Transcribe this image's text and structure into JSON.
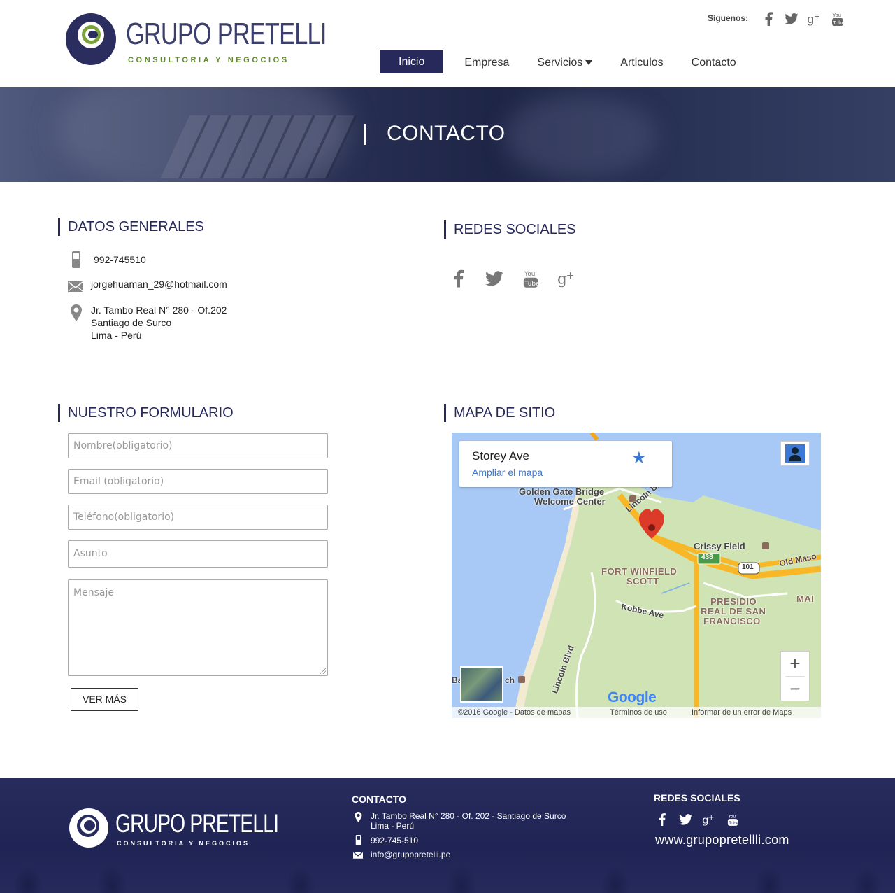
{
  "header": {
    "brand": {
      "name": "GRUPO PRETELLI",
      "tagline": "CONSULTORIA Y NEGOCIOS"
    },
    "follow_label": "Síguenos:",
    "social_icons": [
      "facebook-icon",
      "twitter-icon",
      "google-plus-icon",
      "youtube-icon"
    ],
    "nav": [
      {
        "label": "Inicio",
        "active": true
      },
      {
        "label": "Empresa"
      },
      {
        "label": "Servicios",
        "dropdown": true
      },
      {
        "label": "Articulos"
      },
      {
        "label": "Contacto"
      }
    ]
  },
  "banner": {
    "title": "CONTACTO"
  },
  "datos": {
    "title": "DATOS GENERALES",
    "phone": "992-745510",
    "email": "jorgehuaman_29@hotmail.com",
    "address": [
      "Jr. Tambo Real N° 280 - Of.202",
      "Santiago de Surco",
      "Lima - Perú"
    ]
  },
  "redes": {
    "title": "REDES SOCIALES"
  },
  "form": {
    "title": "NUESTRO FORMULARIO",
    "fields": {
      "nombre": "Nombre(obligatorio)",
      "email": "Email (obligatorio)",
      "telefono": "Teléfono(obligatorio)",
      "asunto": "Asunto",
      "mensaje": "Mensaje"
    },
    "submit_label": "VER MÁS"
  },
  "map": {
    "title": "MAPA DE SITIO",
    "card_title": "Storey Ave",
    "card_link": "Ampliar el mapa",
    "labels": {
      "golden_gate": "Golden Gate Bridge",
      "welcome": "Welcome Center",
      "lincoln_top": "Lincoln Blvd",
      "crissy": "Crissy Field",
      "old_mason": "Old Maso",
      "fort1": "FORT WINFIELD",
      "fort2": "SCOTT",
      "presidio1": "PRESIDIO",
      "presidio2": "REAL DE SAN",
      "presidio3": "FRANCISCO",
      "kobbe": "Kobbe Ave",
      "lincoln_bottom": "Lincoln Blvd",
      "mai": "MAI",
      "shield_438": "438",
      "shield_101": "101",
      "beach_a": "Ba",
      "beach_b": "ch"
    },
    "google": "Google",
    "zoom_in": "+",
    "zoom_out": "−",
    "footer": {
      "copyright": "©2016 Google - Datos de mapas",
      "terms": "Términos de uso",
      "report": "Informar de un error de Maps"
    }
  },
  "footer": {
    "brand": {
      "name": "GRUPO PRETELLI",
      "tagline": "CONSULTORIA Y NEGOCIOS"
    },
    "contact_title": "CONTACTO",
    "address": [
      "Jr. Tambo Real N° 280 - Of. 202 - Santiago de Surco",
      "Lima - Perú"
    ],
    "phone": "992-745-510",
    "email": "info@grupopretelli.pe",
    "social_title": "REDES SOCIALES",
    "website": "www.grupopretellli.com"
  }
}
